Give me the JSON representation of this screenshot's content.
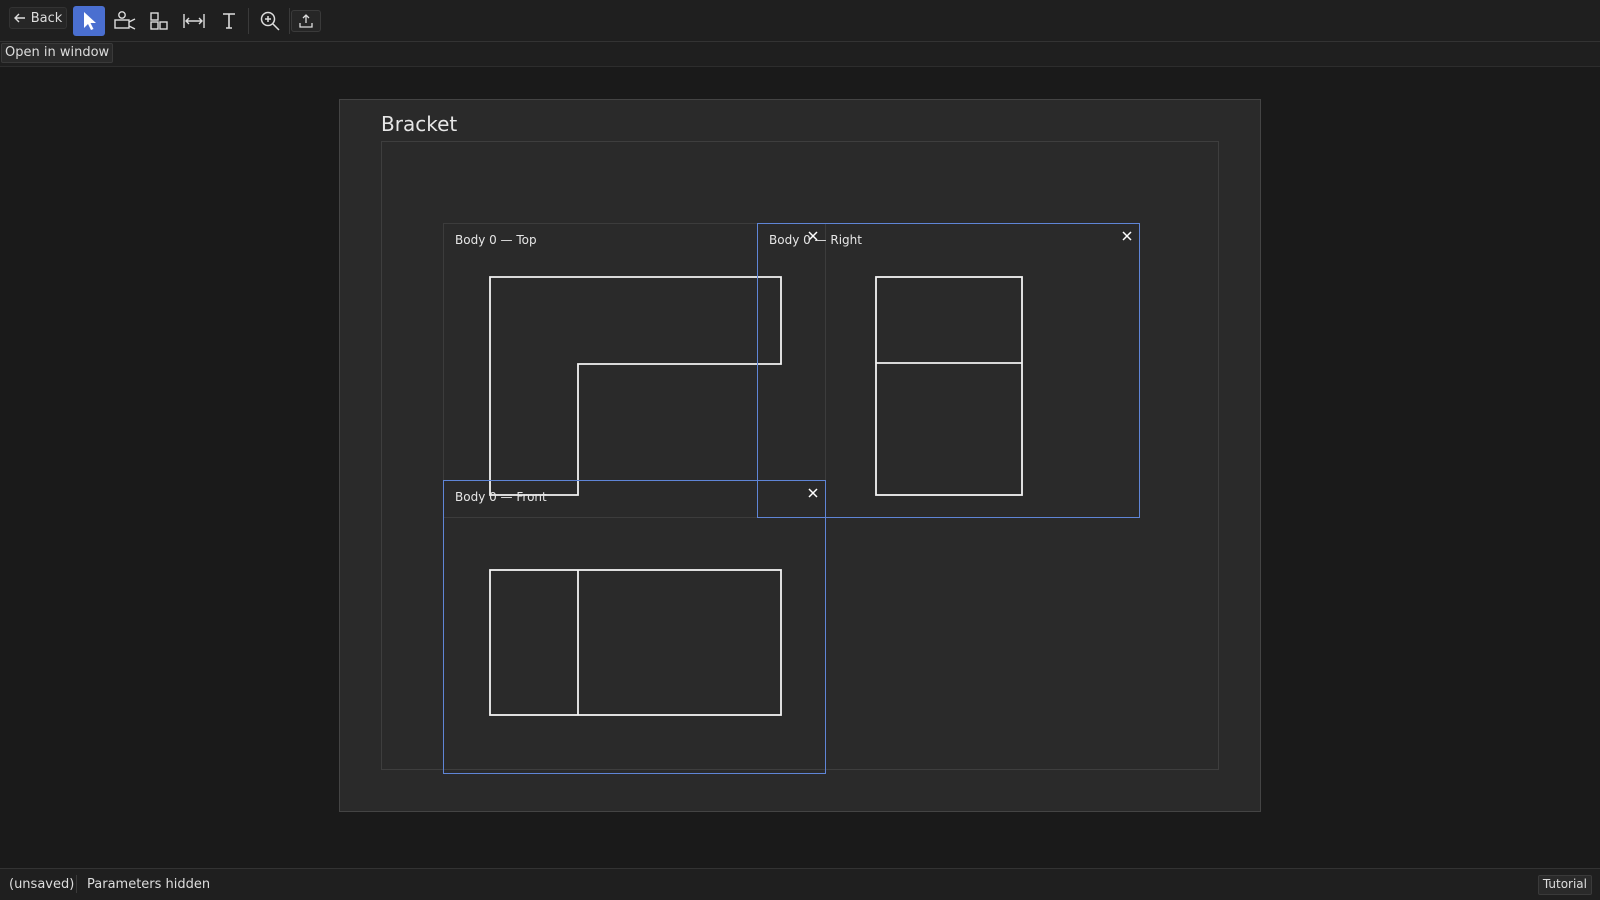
{
  "toolbar": {
    "back_label": "Back",
    "tools": [
      {
        "name": "select",
        "icon": "pointer-icon",
        "active": true
      },
      {
        "name": "add-view",
        "icon": "camera-view-icon",
        "active": false
      },
      {
        "name": "arrange",
        "icon": "arrange-views-icon",
        "active": false
      },
      {
        "name": "dimension",
        "icon": "dimension-icon",
        "active": false
      },
      {
        "name": "text",
        "icon": "text-icon",
        "active": false
      },
      {
        "name": "zoom",
        "icon": "zoom-in-icon",
        "active": false
      },
      {
        "name": "export",
        "icon": "export-icon",
        "active": false
      }
    ],
    "accent_color": "#4a6fd0"
  },
  "open_window_label": "Open in window",
  "sheet": {
    "title": "Bracket",
    "views": [
      {
        "id": "top",
        "title": "Body 0 — Top",
        "selected": false
      },
      {
        "id": "right",
        "title": "Body 0 — Right",
        "selected": true
      },
      {
        "id": "front",
        "title": "Body 0 — Front",
        "selected": true
      }
    ],
    "selection_color": "#5f85d6"
  },
  "status": {
    "save_state": "(unsaved)",
    "parameters": "Parameters hidden",
    "tutorial_label": "Tutorial"
  }
}
